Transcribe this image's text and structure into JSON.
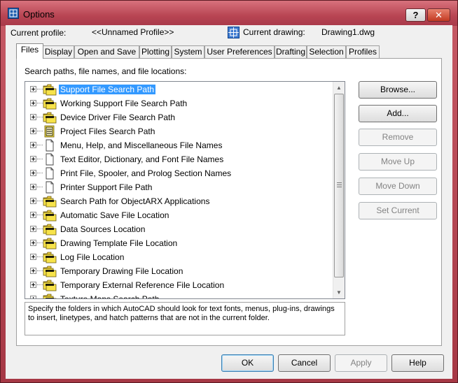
{
  "window": {
    "title": "Options",
    "help_label": "?",
    "close_label": "✕"
  },
  "profile": {
    "current_profile_label": "Current profile:",
    "current_profile_value": "<<Unnamed Profile>>",
    "current_drawing_label": "Current drawing:",
    "current_drawing_value": "Drawing1.dwg"
  },
  "tabs": [
    {
      "label": "Files",
      "active": true
    },
    {
      "label": "Display"
    },
    {
      "label": "Open and Save"
    },
    {
      "label": "Plotting"
    },
    {
      "label": "System"
    },
    {
      "label": "User Preferences"
    },
    {
      "label": "Drafting"
    },
    {
      "label": "Selection"
    },
    {
      "label": "Profiles"
    }
  ],
  "files": {
    "section_label": "Search paths, file names, and file locations:",
    "tree": [
      {
        "label": "Support File Search Path",
        "icon": "folder-stack-icon",
        "selected": true
      },
      {
        "label": "Working Support File Search Path",
        "icon": "folder-stack-icon"
      },
      {
        "label": "Device Driver File Search Path",
        "icon": "folder-stack-icon"
      },
      {
        "label": "Project Files Search Path",
        "icon": "project-file-icon"
      },
      {
        "label": "Menu, Help, and Miscellaneous File Names",
        "icon": "document-icon"
      },
      {
        "label": "Text Editor, Dictionary, and Font File Names",
        "icon": "document-icon"
      },
      {
        "label": "Print File, Spooler, and Prolog Section Names",
        "icon": "document-icon"
      },
      {
        "label": "Printer Support File Path",
        "icon": "document-icon"
      },
      {
        "label": "Search Path for ObjectARX Applications",
        "icon": "folder-stack-icon"
      },
      {
        "label": "Automatic Save File Location",
        "icon": "folder-stack-icon"
      },
      {
        "label": "Data Sources Location",
        "icon": "folder-stack-icon"
      },
      {
        "label": "Drawing Template File Location",
        "icon": "folder-stack-icon"
      },
      {
        "label": "Log File Location",
        "icon": "folder-stack-icon"
      },
      {
        "label": "Temporary Drawing File Location",
        "icon": "folder-stack-icon"
      },
      {
        "label": "Temporary External Reference File Location",
        "icon": "folder-stack-icon"
      },
      {
        "label": "Texture Maps Search Path",
        "icon": "folder-stack-icon"
      }
    ],
    "description": "Specify the folders in which AutoCAD should look for text fonts, menus, plug-ins, drawings to insert, linetypes, and hatch patterns that are not in the current folder.",
    "buttons": {
      "browse": "Browse...",
      "add": "Add...",
      "remove": "Remove",
      "move_up": "Move Up",
      "move_down": "Move Down",
      "set_current": "Set Current"
    }
  },
  "footer": {
    "ok": "OK",
    "cancel": "Cancel",
    "apply": "Apply",
    "help": "Help"
  },
  "colors": {
    "accent_selection": "#3399ff",
    "folder_yellow": "#f7e34a",
    "title_bar": "#b84553"
  }
}
